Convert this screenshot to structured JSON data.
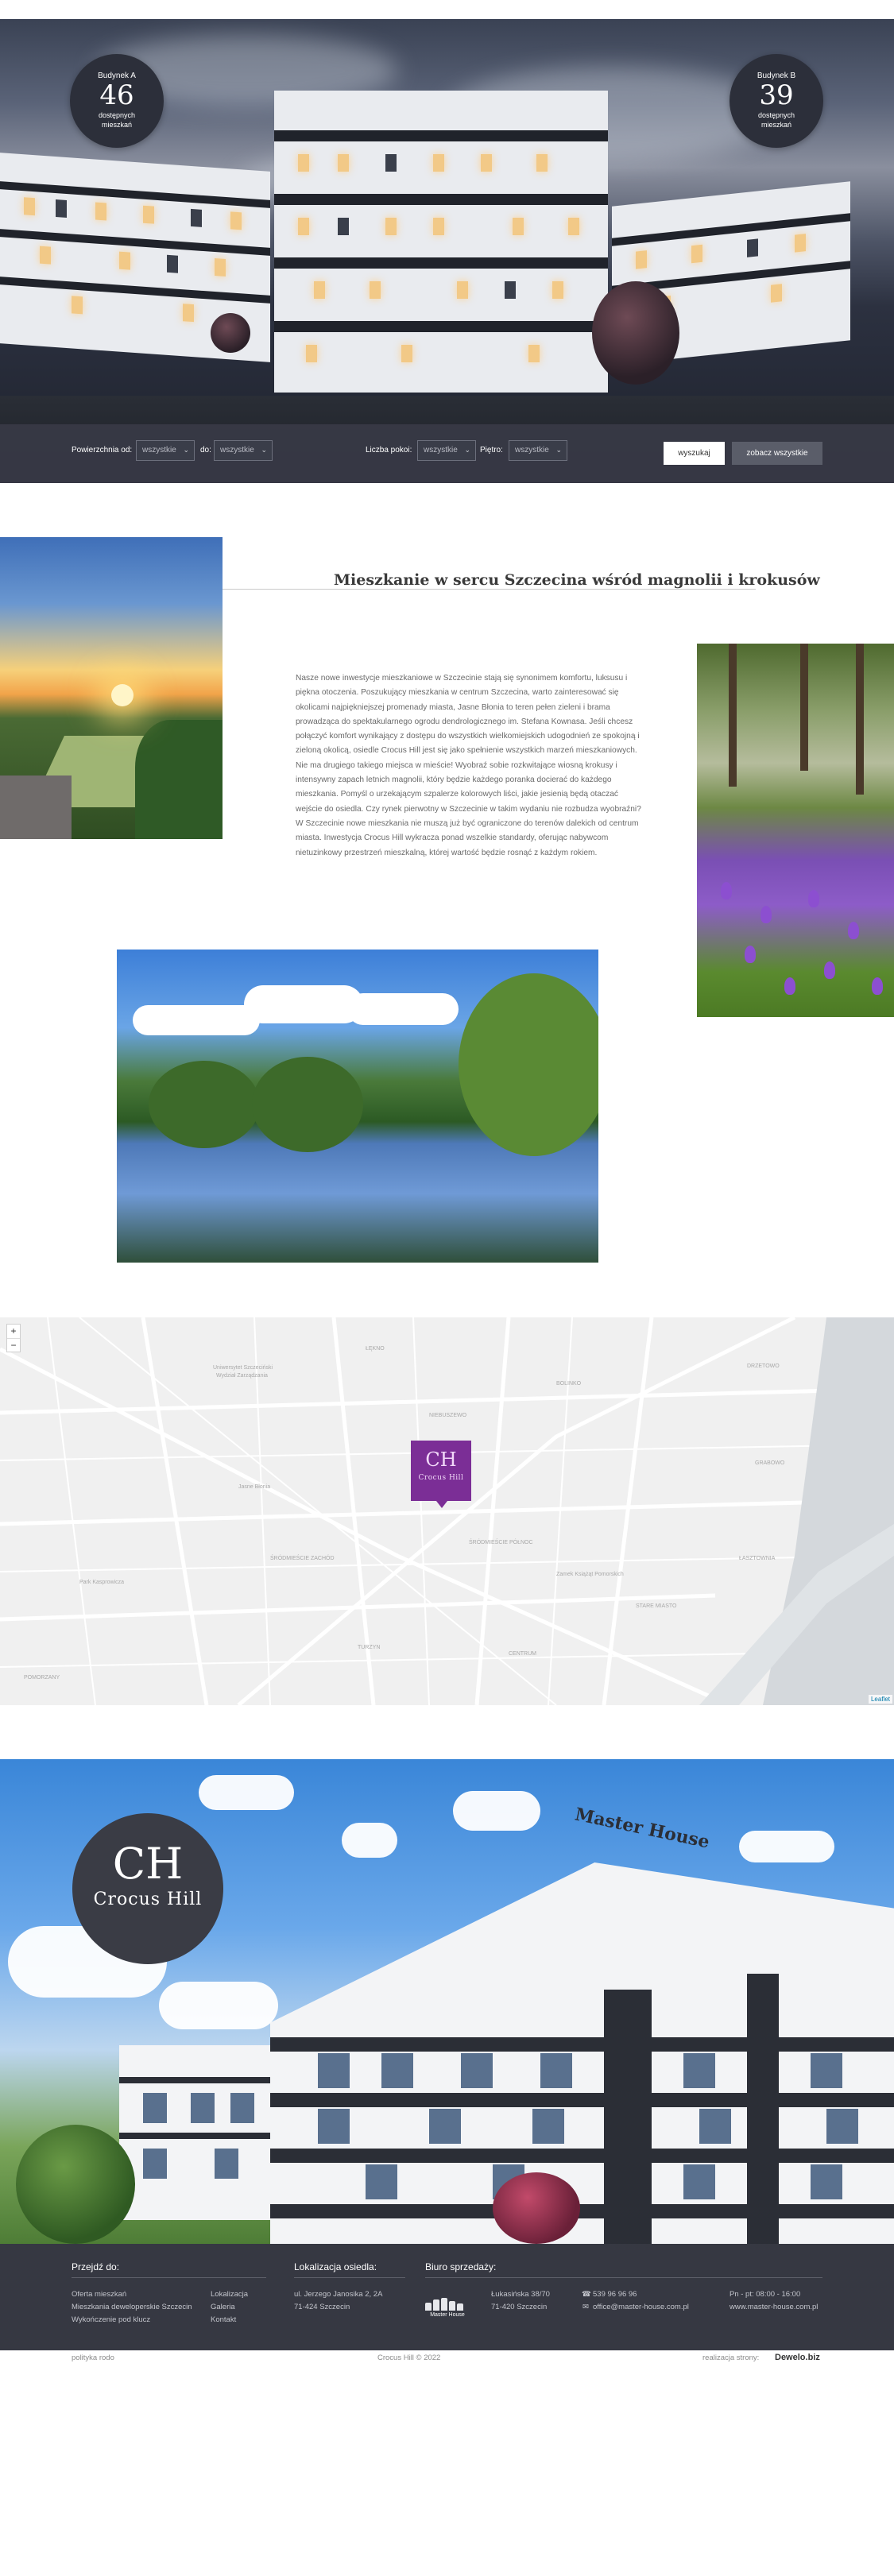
{
  "hero": {
    "building_a": {
      "title": "Budynek A",
      "count": "46",
      "sub1": "dostępnych",
      "sub2": "mieszkań"
    },
    "building_b": {
      "title": "Budynek B",
      "count": "39",
      "sub1": "dostępnych",
      "sub2": "mieszkań"
    },
    "filters": {
      "area_from_label": "Powierzchnia od:",
      "area_from_value": "wszystkie",
      "area_to_label": "do:",
      "area_to_value": "wszystkie",
      "rooms_label": "Liczba pokoi:",
      "rooms_value": "wszystkie",
      "floor_label": "Piętro:",
      "floor_value": "wszystkie",
      "search_label": "wyszukaj",
      "show_all_label": "zobacz wszystkie"
    }
  },
  "intro": {
    "title": "Mieszkanie w sercu Szczecina wśród magnolii i krokusów",
    "text": "Nasze nowe inwestycje mieszkaniowe w Szczecinie stają się synonimem komfortu, luksusu i piękna otoczenia. Poszukujący mieszkania w centrum Szczecina, warto zainteresować się okolicami najpiękniejszej promenady miasta, Jasne Błonia to teren pełen zieleni i brama prowadząca do spektakularnego ogrodu dendrologicznego im. Stefana Kownasa. Jeśli chcesz połączyć komfort wynikający z dostępu do wszystkich wielkomiejskich udogodnień ze spokojną i zieloną okolicą, osiedle Crocus Hill jest się jako spełnienie wszystkich marzeń mieszkaniowych. Nie ma drugiego takiego miejsca w mieście! Wyobraź sobie rozkwitające wiosną krokusy i intensywny zapach letnich magnolii, który będzie każdego poranka docierać do każdego mieszkania. Pomyśl o urzekającym szpalerze kolorowych liści, jakie jesienią będą otaczać wejście do osiedla. Czy rynek pierwotny w Szczecinie w takim wydaniu nie rozbudza wyobraźni? W Szczecinie nowe mieszkania nie muszą już być ograniczone do terenów dalekich od centrum miasta. Inwestycja Crocus Hill wykracza ponad wszelkie standardy, oferując nabywcom nietuzinkowy przestrzeń mieszkalną, której wartość będzie rosnąć z każdym rokiem."
  },
  "map": {
    "zoom_in": "+",
    "zoom_out": "−",
    "marker_mono": "CH",
    "marker_name": "Crocus Hill",
    "attribution": "Leaflet",
    "labels": [
      "Uniwersytet Szczeciński",
      "Wydział Zarządzania",
      "ŁĘKNO",
      "NIEBUSZEWO",
      "BOLINKO",
      "DRZETOWO",
      "GRABOWO",
      "ŚRÓDMIEŚCIE PÓŁNOC",
      "CENTRUM",
      "ŚRÓDMIEŚCIE ZACHÓD",
      "STARE MIASTO",
      "ŁASZTOWNIA",
      "POMORZANY",
      "TURZYN",
      "Jasne Błonia",
      "Park Kasprowicza",
      "Zamek Książąt Pomorskich"
    ]
  },
  "render": {
    "logo_mono": "CH",
    "logo_name": "Crocus Hill",
    "sign": "Master House"
  },
  "footer": {
    "nav_heading": "Przejdź do:",
    "nav_col1": [
      "Oferta mieszkań",
      "Mieszkania deweloperskie Szczecin",
      "Wykończenie pod klucz"
    ],
    "nav_col2": [
      "Lokalizacja",
      "Galeria",
      "Kontakt"
    ],
    "location_heading": "Lokalizacja osiedla:",
    "location_lines": [
      "ul. Jerzego Janosika 2, 2A",
      "71-424 Szczecin"
    ],
    "sales_heading": "Biuro sprzedaży:",
    "mh_logo_text": "Master House",
    "sales_address": [
      "Łukasińska 38/70",
      "71-420 Szczecin"
    ],
    "phone": "539 96 96 96",
    "email": "office@master-house.com.pl",
    "hours": "Pn - pt: 08:00 - 16:00",
    "website": "www.master-house.com.pl"
  },
  "subfooter": {
    "privacy": "polityka rodo",
    "copyright": "Crocus Hill © 2022",
    "credit_label": "realizacja strony:",
    "credit_brand": "Dewelo.biz"
  },
  "colors": {
    "marker": "#7b2e96",
    "footer_bg": "#2e303a",
    "filter_bg": "#383a46",
    "accent_button": "#5a5d69"
  },
  "icons": [
    "chevron-down-icon",
    "phone-icon",
    "mail-icon",
    "crocus-hill-logo",
    "master-house-logo",
    "zoom-in-icon",
    "zoom-out-icon",
    "map-marker-icon"
  ]
}
